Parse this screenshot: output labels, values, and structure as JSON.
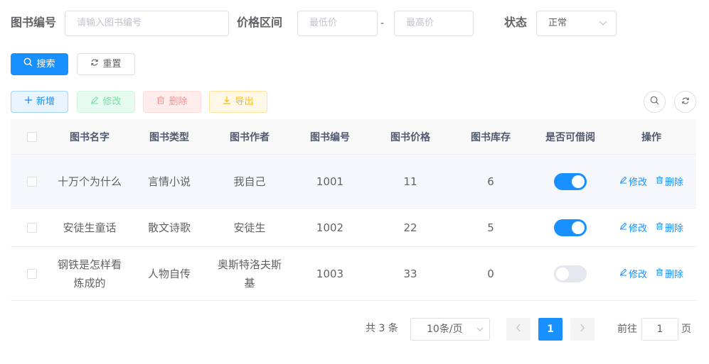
{
  "search": {
    "book_no_label": "图书编号",
    "book_no_placeholder": "请输入图书编号",
    "price_label": "价格区间",
    "min_price_placeholder": "最低价",
    "dash": "-",
    "max_price_placeholder": "最高价",
    "status_label": "状态",
    "status_value": "正常",
    "search_btn": "搜索",
    "reset_btn": "重置"
  },
  "toolbar": {
    "add": "新增",
    "edit": "修改",
    "delete": "删除",
    "export": "导出"
  },
  "table": {
    "columns": [
      "图书名字",
      "图书类型",
      "图书作者",
      "图书编号",
      "图书价格",
      "图书库存",
      "是否可借阅",
      "操作"
    ],
    "rows": [
      {
        "name": "十万个为什么",
        "type": "言情小说",
        "author": "我自己",
        "no": "1001",
        "price": "11",
        "stock": "6",
        "borrowable": true
      },
      {
        "name": "安徒生童话",
        "type": "散文诗歌",
        "author": "安徒生",
        "no": "1002",
        "price": "22",
        "stock": "5",
        "borrowable": true
      },
      {
        "name": "钢铁是怎样看炼成的",
        "type": "人物自传",
        "author": "奥斯特洛夫斯基",
        "no": "1003",
        "price": "33",
        "stock": "0",
        "borrowable": false
      }
    ],
    "op_edit": "修改",
    "op_delete": "删除"
  },
  "pagination": {
    "total": "共 3 条",
    "page_size": "10条/页",
    "current_page": "1",
    "goto_prefix": "前往",
    "goto_value": "1",
    "goto_suffix": "页"
  },
  "colors": {
    "primary": "#1890ff",
    "switch_off": "#e4e7ed"
  }
}
